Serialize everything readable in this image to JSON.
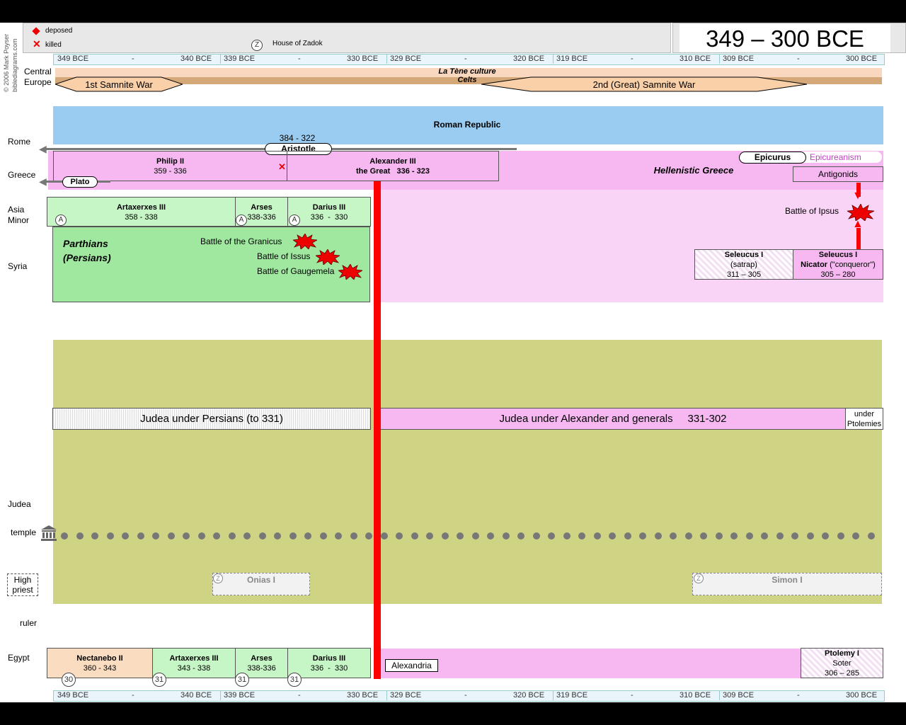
{
  "title": "349 – 300 BCE",
  "copyright": "© 2006 Mark Poyser",
  "site": "biblediagrams.com",
  "legend": {
    "deposed": "deposed",
    "killed": "killed",
    "zadok_symbol": "Z",
    "zadok": "House of Zadok"
  },
  "ruler_labels": [
    "349 BCE",
    "-",
    "340 BCE",
    "339 BCE",
    "-",
    "330 BCE",
    "329 BCE",
    "-",
    "320 BCE",
    "319 BCE",
    "-",
    "310 BCE",
    "309 BCE",
    "-",
    "300 BCE"
  ],
  "rows": {
    "central_europe": "Central Europe",
    "rome": "Rome",
    "greece": "Greece",
    "asia_minor": "Asia Minor",
    "syria": "Syria",
    "judea": "Judea",
    "temple": "temple",
    "high_priest": "High priest",
    "ruler": "ruler",
    "egypt": "Egypt"
  },
  "central_europe": {
    "la_tene": "La Tène culture",
    "celts": "Celts",
    "samnite1": "1st Samnite War",
    "samnite2": "2nd (Great) Samnite War"
  },
  "rome": {
    "republic": "Roman Republic"
  },
  "greece": {
    "aristotle_dates": "384 - 322",
    "aristotle": "Aristotle",
    "plato": "Plato",
    "philip_name": "Philip II",
    "philip_dates": "359 - 336",
    "alexander_name": "Alexander III",
    "alexander_line2": "the Great   336 - 323",
    "epicurus": "Epicurus",
    "epicureanism": "Epicureanism",
    "hellenistic": "Hellenistic Greece",
    "antigonids": "Antigonids"
  },
  "asia_minor": {
    "artaxerxes_name": "Artaxerxes III",
    "artaxerxes_dates": "358 - 338",
    "arses_name": "Arses",
    "arses_dates": "338-336",
    "darius_name": "Darius III",
    "darius_dates": "336  -  330",
    "a_symbol": "A",
    "ipsus": "Battle of Ipsus"
  },
  "syria": {
    "parthians_line1": "Parthians",
    "parthians_line2": "(Persians)",
    "granicus": "Battle of the Granicus",
    "issus": "Battle of Issus",
    "gaugemela": "Battle of Gaugemela",
    "seleucus1_name": "Seleucus I",
    "seleucus1_role": "(satrap)",
    "seleucus1_dates": "311 – 305",
    "seleucus2_name": "Seleucus I",
    "seleucus2_role": "Nicator (\"conqueror\")",
    "seleucus2_role_bold": "Nicator",
    "seleucus2_role_rest": " (\"conqueror\")",
    "seleucus2_dates": "305 – 280"
  },
  "judea": {
    "persians": "Judea under Persians (to 331)",
    "alexander": "Judea under Alexander and generals     331-302",
    "ptolemies_line1": "under",
    "ptolemies_line2": "Ptolemies",
    "onias": "Onias I",
    "simon": "Simon I"
  },
  "egypt": {
    "nectanebo_name": "Nectanebo II",
    "nectanebo_dates": "360 - 343",
    "artaxerxes_name": "Artaxerxes III",
    "artaxerxes_dates": "343 - 338",
    "arses_name": "Arses",
    "arses_dates": "338-336",
    "darius_name": "Darius III",
    "darius_dates": "336  -  330",
    "dyn30": "30",
    "dyn31": "31",
    "alexandria": "Alexandria",
    "ptolemy_name": "Ptolemy I",
    "ptolemy_role": "Soter",
    "ptolemy_dates": "306 – 285"
  },
  "colors": {
    "rome": "#99ccf0",
    "greece": "#f7b8f2",
    "greece_light": "#f9d4f6",
    "persia_light": "#c6f5c6",
    "persia": "#a0e8a0",
    "judea": "#cfd485",
    "red_line": "#ff0000",
    "europe_light": "#fad8c0",
    "europe_dark": "#d4a878",
    "war_fill": "#f9d0a8",
    "nectanebo": "#fadcc0"
  }
}
